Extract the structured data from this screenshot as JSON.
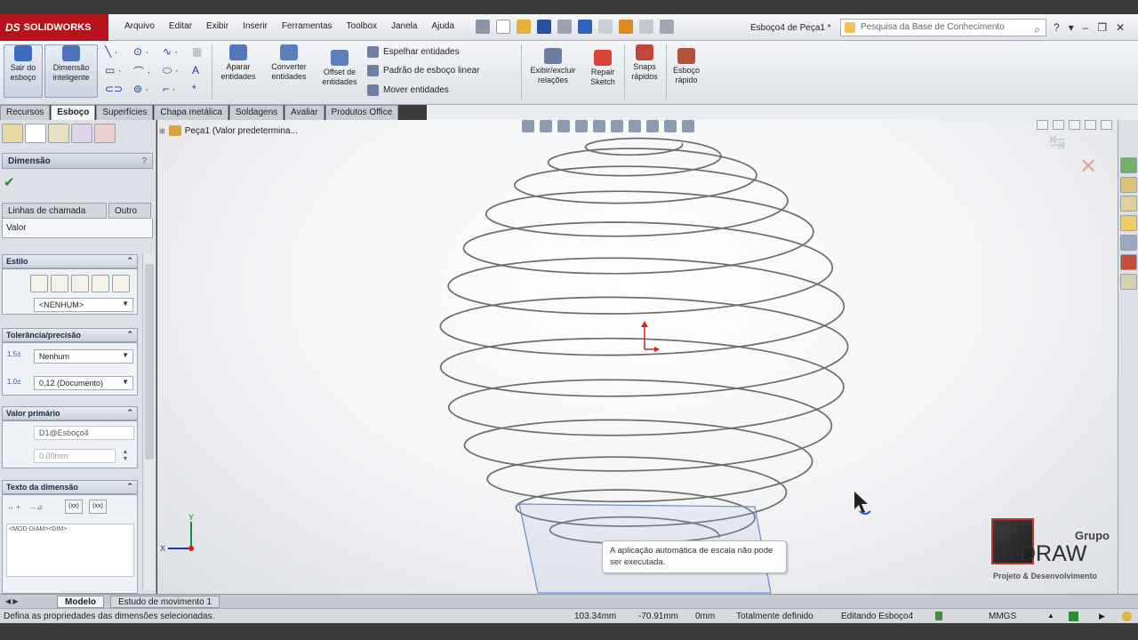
{
  "app": {
    "brand": "SOLIDWORKS",
    "menus": [
      "Arquivo",
      "Editar",
      "Exibir",
      "Inserir",
      "Ferramentas",
      "Toolbox",
      "Janela",
      "Ajuda"
    ],
    "document_title": "Esboço4 de Peça1 *",
    "search_placeholder": "Pesquisa da Base de Conhecimento"
  },
  "commands": {
    "exit_sketch": "Sair do esboço",
    "smart_dimension": "Dimensão inteligente",
    "trim": "Aparar entidades",
    "convert": "Converter entidades",
    "offset": "Offset de entidades",
    "mirror": "Espelhar entidades",
    "linear_pattern": "Padrão de esboço linear",
    "move": "Mover entidades",
    "display_relations": "Exibir/excluir relações",
    "repair": "Repair Sketch",
    "quick_snaps": "Snaps rápidos",
    "rapid_sketch": "Esboço rápido"
  },
  "tabs": [
    {
      "label": "Recursos",
      "active": false
    },
    {
      "label": "Esboço",
      "active": true
    },
    {
      "label": "Superfícies",
      "active": false
    },
    {
      "label": "Chapa metálica",
      "active": false
    },
    {
      "label": "Soldagens",
      "active": false
    },
    {
      "label": "Avaliar",
      "active": false
    },
    {
      "label": "Produtos Office",
      "active": false
    }
  ],
  "property_manager": {
    "title": "Dimensão",
    "subtabs": [
      "Linhas de chamada",
      "Outro"
    ],
    "value_tab": "Valor",
    "style": {
      "header": "Estilo",
      "select": "<NENHUM>"
    },
    "tolerance": {
      "header": "Tolerância/precisão",
      "tolerance_select": "Nenhum",
      "precision_select": "0,12 (Documento)"
    },
    "primary_value": {
      "header": "Valor primário",
      "name": "D1@Esboço4",
      "value": "0.00mm"
    },
    "dimension_text": {
      "header": "Texto da dimensão",
      "content": "<MOD-DIAM><DIM>"
    }
  },
  "graphics": {
    "tree_label": "Peça1  (Valor predetermina...",
    "tooltip": "A aplicação automática de escala não pode ser executada."
  },
  "watermark": {
    "grupo": "Grupo",
    "brand_a": "Re",
    "brand_b": "DRAW",
    "subtitle": "Projeto & Desenvolvimento"
  },
  "bottom_tabs": [
    "Modelo",
    "Estudo de movimento 1"
  ],
  "status": {
    "message": "Defina as propriedades das dimensões selecionadas.",
    "x": "103.34mm",
    "y": "-70.91mm",
    "z": "0mm",
    "state": "Totalmente definido",
    "editing": "Editando Esboço4",
    "units": "MMGS"
  },
  "colors": {
    "brand": "#b5121b",
    "accent": "#1b3d8f",
    "spiral": "#6c6c6c",
    "origin": "#d0231b"
  }
}
